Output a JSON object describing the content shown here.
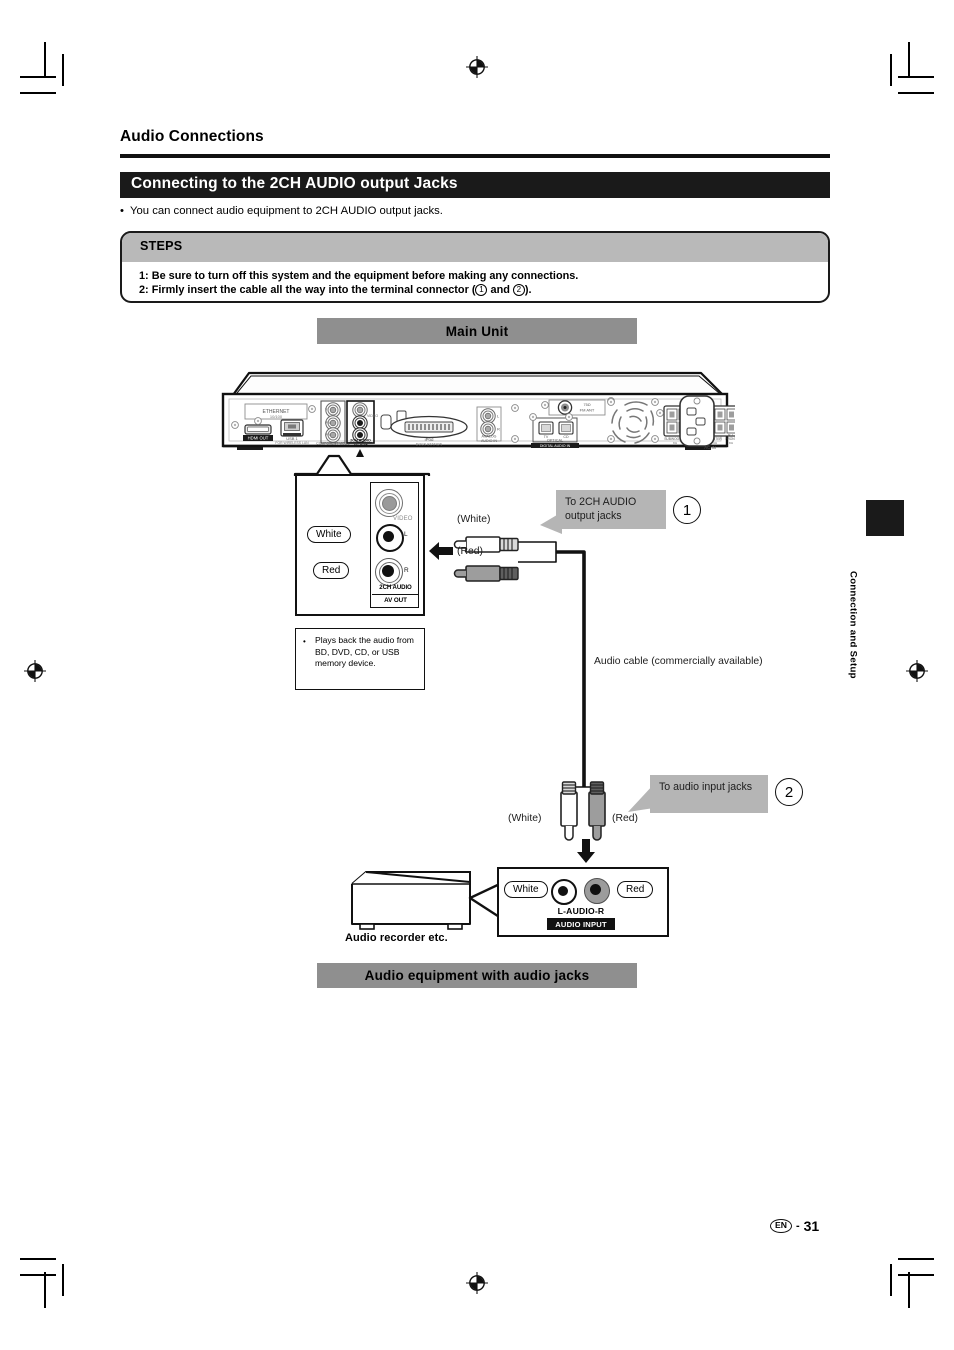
{
  "document": {
    "section_title": "Audio Connections",
    "heading": "Connecting to the 2CH AUDIO output Jacks",
    "intro_bullet": "You can connect audio equipment to 2CH AUDIO output jacks.",
    "side_tab": "Connection and Setup",
    "footer": {
      "language_code": "EN",
      "separator": "-",
      "page_number": "31"
    }
  },
  "steps": {
    "header": "STEPS",
    "step1": "1: Be sure to turn off this system and the equipment before making any connections.",
    "step2_prefix": "2: Firmly insert the cable all the way into the terminal connector (",
    "step2_num1": "1",
    "step2_mid": " and ",
    "step2_num2": "2",
    "step2_suffix": ")."
  },
  "diagram": {
    "main_unit_banner": "Main Unit",
    "bottom_banner": "Audio equipment with audio jacks",
    "jack_detail": {
      "video_label": "VIDEO",
      "l_label": "L",
      "r_label": "R",
      "group_label": "2CH AUDIO",
      "group_sublabel": "AV OUT",
      "pill_white": "White",
      "pill_red": "Red"
    },
    "note_box": {
      "bullet": "•",
      "text": "Plays back the audio from BD, DVD, CD, or USB memory device."
    },
    "plug_top": {
      "white": "(White)",
      "red": "(Red)"
    },
    "plug_bottom": {
      "white": "(White)",
      "red": "(Red)"
    },
    "callout_1": {
      "text": "To 2CH AUDIO output jacks",
      "number": "1"
    },
    "callout_2": {
      "text": "To audio input jacks",
      "number": "2"
    },
    "cable_caption": "Audio cable (commercially available)",
    "recorder": {
      "caption": "Audio recorder etc.",
      "pill_white": "White",
      "pill_red": "Red",
      "jack_label": "L-AUDIO-R",
      "badge": "AUDIO INPUT"
    }
  },
  "rear_panel": {
    "labels": [
      "ETHERNET",
      "HDMI OUT",
      "USB 1",
      "VIDEO",
      "2CH AUDIO AV OUT",
      "iPod",
      "ANALOG AUDIO IN",
      "FM ANT",
      "OPTICAL",
      "DIGITAL AUDIO IN",
      "SUBWOOFER",
      "SURROUND",
      "CENTER",
      "FRONT",
      "AC IN"
    ]
  },
  "colors": {
    "section_bar": "#1a1a1a",
    "banner_gray": "#8f8f8f",
    "callout_gray": "#b5b5b5",
    "steps_header_gray": "#b9b9b9"
  }
}
